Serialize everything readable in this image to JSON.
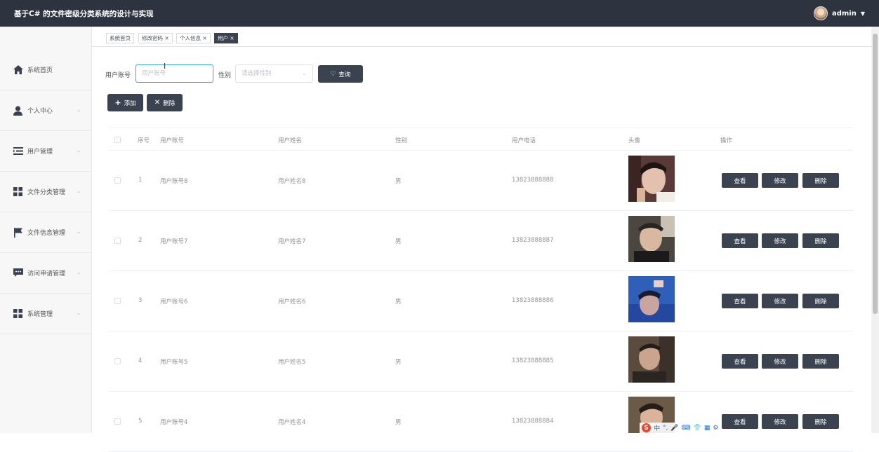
{
  "app": {
    "title": "基于C# 的文件密级分类系统的设计与实现",
    "user": "admin"
  },
  "sidebar": {
    "items": [
      {
        "label": "系统首页",
        "icon": "home-icon"
      },
      {
        "label": "个人中心",
        "icon": "user-icon"
      },
      {
        "label": "用户管理",
        "icon": "list-indent-icon"
      },
      {
        "label": "文件分类管理",
        "icon": "grid-icon"
      },
      {
        "label": "文件信息管理",
        "icon": "flag-icon"
      },
      {
        "label": "访问申请管理",
        "icon": "chat-icon"
      },
      {
        "label": "系统管理",
        "icon": "grid-icon"
      }
    ]
  },
  "tabs": [
    {
      "label": "系统首页"
    },
    {
      "label": "修改密码 ×"
    },
    {
      "label": "个人信息 ×"
    },
    {
      "label": "用户 ×"
    }
  ],
  "search": {
    "account_label": "用户账号",
    "account_placeholder": "用户账号",
    "gender_label": "性别",
    "gender_placeholder": "请选择性别",
    "query_label": "查询"
  },
  "toolbar": {
    "add_label": "添加",
    "delete_label": "删除"
  },
  "table": {
    "headers": [
      "序号",
      "用户账号",
      "用户姓名",
      "性别",
      "用户电话",
      "头像",
      "操作"
    ],
    "rows": [
      {
        "index": "1",
        "account": "用户账号8",
        "name": "用户姓名8",
        "gender": "男",
        "phone": "13823888888"
      },
      {
        "index": "2",
        "account": "用户账号7",
        "name": "用户姓名7",
        "gender": "男",
        "phone": "13823888887"
      },
      {
        "index": "3",
        "account": "用户账号6",
        "name": "用户姓名6",
        "gender": "男",
        "phone": "13823888886"
      },
      {
        "index": "4",
        "account": "用户账号5",
        "name": "用户姓名5",
        "gender": "男",
        "phone": "13823888885"
      },
      {
        "index": "5",
        "account": "用户账号4",
        "name": "用户姓名4",
        "gender": "男",
        "phone": "13823888884"
      }
    ],
    "actions": {
      "view": "查看",
      "edit": "修改",
      "delete": "删除"
    }
  },
  "ime": {
    "logo": "S",
    "mode": "中"
  },
  "colors": {
    "topbar": "#2d3440",
    "button": "#3b4250",
    "focus": "#3aa6b9"
  }
}
